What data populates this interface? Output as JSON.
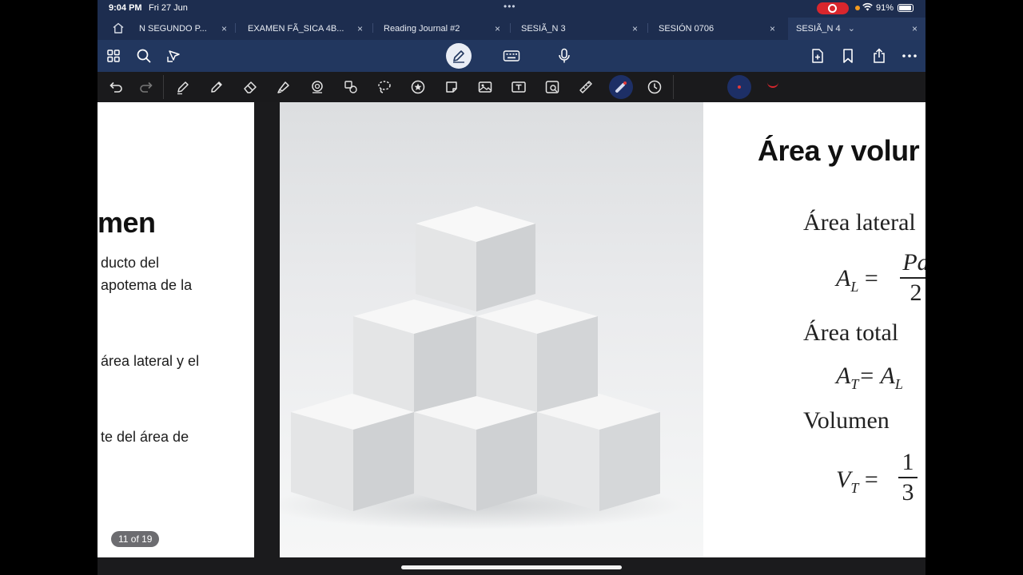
{
  "status_bar": {
    "time": "9:04 PM",
    "date": "Fri 27 Jun",
    "dots": "•••",
    "battery": "91%"
  },
  "tabs": [
    {
      "label": "N SEGUNDO P...",
      "close": "×",
      "active": false
    },
    {
      "label": "EXAMEN FÃ_SICA 4B...",
      "close": "×",
      "active": false
    },
    {
      "label": "Reading Journal #2",
      "close": "×",
      "active": false
    },
    {
      "label": "SESIÃ_N 3",
      "close": "×",
      "active": false
    },
    {
      "label": "SESIÓN 0706",
      "close": "×",
      "active": false
    },
    {
      "label": "SESIÃ_N 4",
      "dropdown": "⌄",
      "close": "×",
      "active": true
    }
  ],
  "toolbar": {
    "icons": [
      "grid-icon",
      "search-icon",
      "pointer-icon",
      "pen-mode-icon",
      "keyboard-icon",
      "microphone-icon",
      "add-page-icon",
      "bookmark-icon",
      "share-icon",
      "more-icon"
    ]
  },
  "tools": {
    "icons": [
      "undo-icon",
      "redo-icon",
      "pen-icon",
      "pencil-icon",
      "eraser-icon",
      "highlighter-icon",
      "shapes-icon",
      "elements-icon",
      "lasso-icon",
      "sticker-icon",
      "sticky-note-icon",
      "image-icon",
      "text-icon",
      "camera-icon",
      "ruler-icon",
      "laser-pointer-icon",
      "timer-icon"
    ],
    "colors": {
      "pen": "#1d2f66",
      "dot": "#e23a3a",
      "stroke": "#d8262d"
    }
  },
  "left_page": {
    "title": "men",
    "lines": [
      "ducto del",
      "apotema de la",
      "área lateral y el",
      "te del área de"
    ],
    "page_counter": "11 of 19"
  },
  "right_page": {
    "title": "Área y volur",
    "area_lateral_label": "Área lateral",
    "al_lhs": "A",
    "al_sub": "L",
    "al_eq": " =",
    "al_num": "Pa",
    "al_den": "2",
    "area_total_label": "Área total",
    "at_lhs": "A",
    "at_sub": "T",
    "at_eq": "= A",
    "at_sub2": "L",
    "volumen_label": "Volumen",
    "vt_lhs": "V",
    "vt_sub": "T",
    "vt_eq": " =",
    "vt_num": "1",
    "vt_den": "3"
  },
  "colors": {
    "header_bg": "#1d2d4f",
    "toolbar_bg": "#22375f",
    "tools_bg": "#1a1a1c",
    "record": "#d8262d"
  }
}
